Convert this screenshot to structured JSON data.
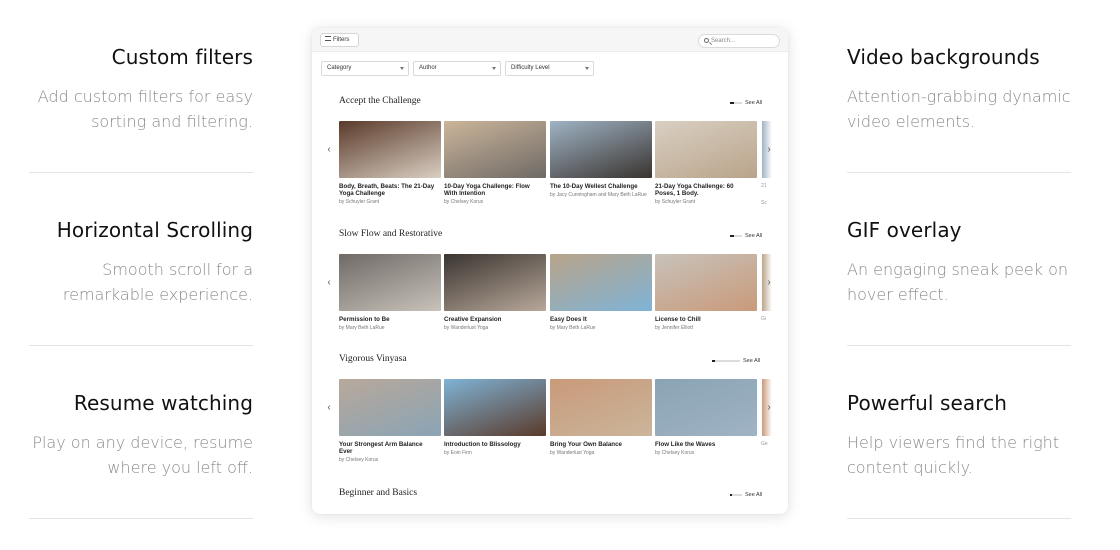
{
  "features_left": [
    {
      "title": "Custom filters",
      "desc_1": "Add custom filters for easy",
      "desc_2": "sorting and filtering."
    },
    {
      "title": "Horizontal Scrolling",
      "desc_1": "Smooth scroll for a",
      "desc_2": "remarkable experience."
    },
    {
      "title": "Resume watching",
      "desc_1": "Play on any device, resume",
      "desc_2": "where you left off."
    }
  ],
  "features_right": [
    {
      "title": "Video backgrounds",
      "desc_1": "Attention-grabbing dynamic",
      "desc_2": "video elements."
    },
    {
      "title": "GIF overlay",
      "desc_1": "An engaging sneak peek on",
      "desc_2": "hover effect."
    },
    {
      "title": "Powerful search",
      "desc_1": "Help viewers find the right",
      "desc_2": "content quickly."
    }
  ],
  "app": {
    "filters_label": "Filters",
    "search_placeholder": "Search...",
    "dropdowns": [
      "Category",
      "Author",
      "Difficulty Level"
    ],
    "see_all_label": "See All",
    "sections": [
      {
        "title": "Accept the Challenge",
        "progress": 0.3,
        "cards": [
          {
            "title_1": "Body, Breath, Beats: The 21-Day",
            "title_2": "Yoga Challenge",
            "author": "by Schuyler Grant"
          },
          {
            "title_1": "10-Day Yoga Challenge: Flow",
            "title_2": "With Intention",
            "author": "by Chelsey Korus"
          },
          {
            "title_1": "The 10-Day Wellest Challenge",
            "title_2": "",
            "author": "by Jacy Cunningham and Mary Beth LaRue"
          },
          {
            "title_1": "21-Day Yoga Challenge: 60",
            "title_2": "Poses, 1 Body.",
            "author": "by Schuyler Grant"
          }
        ],
        "peek_1": "21",
        "peek_2": "Sc"
      },
      {
        "title": "Slow Flow and Restorative",
        "progress": 0.3,
        "cards": [
          {
            "title_1": "Permission to Be",
            "title_2": "",
            "author": "by Mary Beth LaRue"
          },
          {
            "title_1": "Creative Expansion",
            "title_2": "",
            "author": "by Wanderlust Yoga"
          },
          {
            "title_1": "Easy Does It",
            "title_2": "",
            "author": "by Mary Beth LaRue"
          },
          {
            "title_1": "License to Chill",
            "title_2": "",
            "author": "by Jennifer Elliott"
          }
        ],
        "peek_1": "Gi",
        "peek_2": ""
      },
      {
        "title": "Vigorous Vinyasa",
        "progress": 0.1,
        "cards": [
          {
            "title_1": "Your Strongest Arm Balance",
            "title_2": "Ever",
            "author": "by Chelsey Korus"
          },
          {
            "title_1": "Introduction to Blissology",
            "title_2": "",
            "author": "by Eoin Finn"
          },
          {
            "title_1": "Bring Your Own Balance",
            "title_2": "",
            "author": "by Wanderlust Yoga"
          },
          {
            "title_1": "Flow Like the Waves",
            "title_2": "",
            "author": "by Chelsey Korus"
          }
        ],
        "peek_1": "Ge",
        "peek_2": ""
      },
      {
        "title": "Beginner and Basics",
        "progress": 0.2,
        "cards": []
      }
    ]
  },
  "colors": {
    "heading": "#111111",
    "muted_text": "#8a8a8a",
    "divider": "#e4e4e4",
    "thumb_palette": [
      "#5a3a2a",
      "#cbb59a",
      "#9fb3c4",
      "#d9cfc2",
      "#6f6a66",
      "#3a3430",
      "#b9a48a",
      "#c8c2ba",
      "#b8a89a",
      "#7fb3d6",
      "#c99a7a",
      "#8aa4b5"
    ]
  }
}
